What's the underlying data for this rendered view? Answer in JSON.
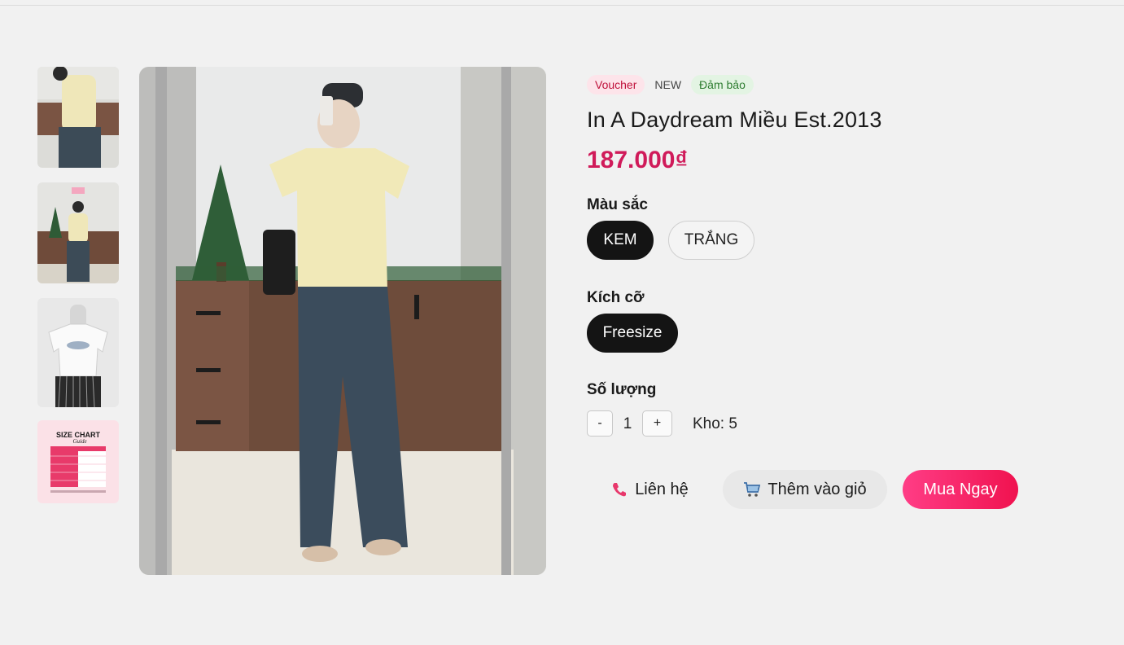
{
  "badges": {
    "voucher": "Voucher",
    "new": "NEW",
    "guarantee": "Đảm bảo"
  },
  "product": {
    "title": "In A Daydream Miều Est.2013",
    "price": "187.000₫"
  },
  "color": {
    "label": "Màu sắc",
    "options": [
      "KEM",
      "TRẮNG"
    ],
    "selected": "KEM"
  },
  "size": {
    "label": "Kích cỡ",
    "options": [
      "Freesize"
    ],
    "selected": "Freesize"
  },
  "quantity": {
    "label": "Số lượng",
    "minus": "-",
    "value": "1",
    "plus": "+",
    "stock": "Kho: 5"
  },
  "actions": {
    "contact": "Liên hệ",
    "add_to_cart": "Thêm vào giỏ",
    "buy_now": "Mua Ngay"
  },
  "size_chart_thumb": {
    "title": "SIZE CHART",
    "subtitle": "Guide"
  },
  "colors": {
    "accent": "#d01b5a",
    "buy_start": "#ff3d86",
    "buy_end": "#f0124f",
    "selected_chip": "#141414"
  }
}
